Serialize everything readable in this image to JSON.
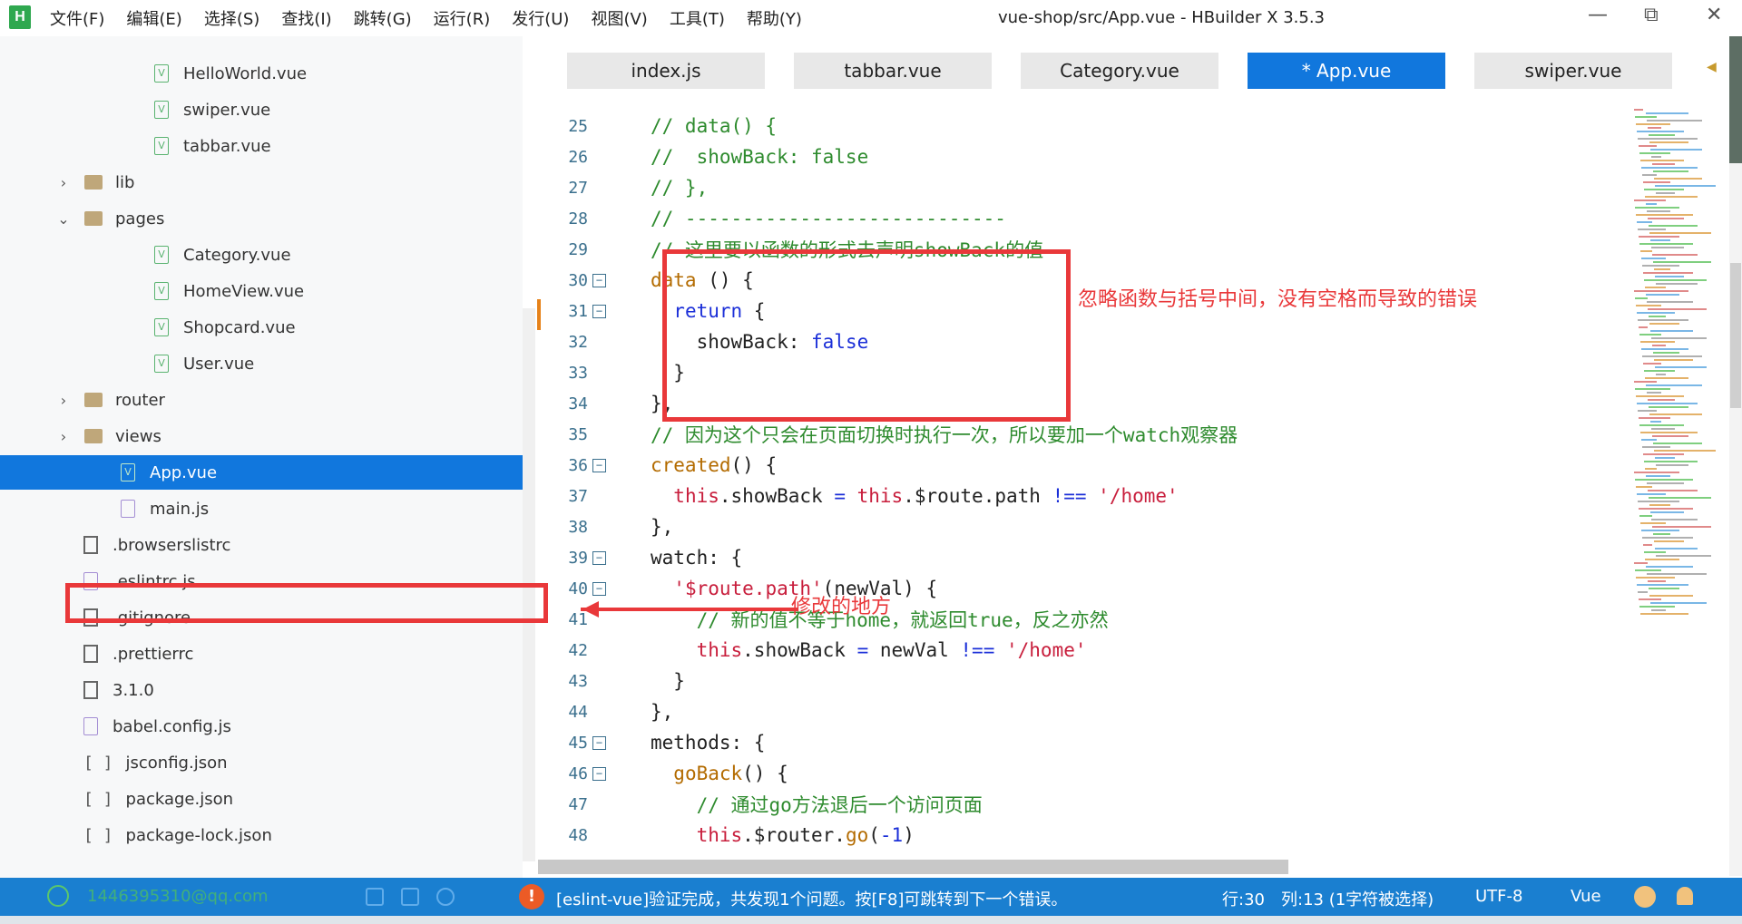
{
  "menu": [
    "文件(F)",
    "编辑(E)",
    "选择(S)",
    "查找(I)",
    "跳转(G)",
    "运行(R)",
    "发行(U)",
    "视图(V)",
    "工具(T)",
    "帮助(Y)"
  ],
  "window_title": "vue-shop/src/App.vue - HBuilder X 3.5.3",
  "window_controls": {
    "minimize": "—",
    "restore": "⧉",
    "close": "✕"
  },
  "logo": "H",
  "sidebar": {
    "items": [
      {
        "label": "HelloWorld.vue",
        "type": "vue"
      },
      {
        "label": "swiper.vue",
        "type": "vue"
      },
      {
        "label": "tabbar.vue",
        "type": "vue"
      },
      {
        "label": "lib",
        "type": "folder",
        "chevron": "›"
      },
      {
        "label": "pages",
        "type": "folder",
        "chevron": "⌄"
      },
      {
        "label": "Category.vue",
        "type": "vue"
      },
      {
        "label": "HomeView.vue",
        "type": "vue"
      },
      {
        "label": "Shopcard.vue",
        "type": "vue"
      },
      {
        "label": "User.vue",
        "type": "vue"
      },
      {
        "label": "router",
        "type": "folder",
        "chevron": "›"
      },
      {
        "label": "views",
        "type": "folder",
        "chevron": "›"
      },
      {
        "label": "App.vue",
        "type": "vue",
        "selected": true
      },
      {
        "label": "main.js",
        "type": "js"
      },
      {
        "label": ".browserslistrc",
        "type": "file"
      },
      {
        "label": ".eslintrc.js",
        "type": "js"
      },
      {
        "label": ".gitignore",
        "type": "file"
      },
      {
        "label": ".prettierrc",
        "type": "file"
      },
      {
        "label": "3.1.0",
        "type": "file"
      },
      {
        "label": "babel.config.js",
        "type": "js"
      },
      {
        "label": "jsconfig.json",
        "type": "json"
      },
      {
        "label": "package.json",
        "type": "json"
      },
      {
        "label": "package-lock.json",
        "type": "json"
      }
    ]
  },
  "tabs": [
    "index.js",
    "tabbar.vue",
    "Category.vue",
    "* App.vue",
    "swiper.vue"
  ],
  "code_lines": [
    {
      "n": "25",
      "fold": "",
      "parts": [
        [
          "g",
          "// data() {"
        ]
      ]
    },
    {
      "n": "26",
      "fold": "",
      "parts": [
        [
          "g",
          "//  showBack: false"
        ]
      ]
    },
    {
      "n": "27",
      "fold": "",
      "parts": [
        [
          "g",
          "// },"
        ]
      ]
    },
    {
      "n": "28",
      "fold": "",
      "parts": [
        [
          "g",
          "// ----------------------------"
        ]
      ]
    },
    {
      "n": "29",
      "fold": "",
      "parts": [
        [
          "g",
          "// 这里要以函数的形式去声明showBack的值"
        ]
      ]
    },
    {
      "n": "30",
      "fold": "−",
      "parts": [
        [
          "o",
          "data"
        ],
        [
          "n",
          " () {"
        ]
      ]
    },
    {
      "n": "31",
      "fold": "−",
      "parts": [
        [
          "n",
          "  "
        ],
        [
          "k",
          "return"
        ],
        [
          "n",
          " {"
        ]
      ]
    },
    {
      "n": "32",
      "fold": "",
      "parts": [
        [
          "n",
          "    showBack: "
        ],
        [
          "k",
          "false"
        ]
      ]
    },
    {
      "n": "33",
      "fold": "",
      "parts": [
        [
          "n",
          "  }"
        ]
      ]
    },
    {
      "n": "34",
      "fold": "",
      "parts": [
        [
          "n",
          "},"
        ]
      ]
    },
    {
      "n": "35",
      "fold": "",
      "parts": [
        [
          "g",
          "// 因为这个只会在页面切换时执行一次，所以要加一个watch观察器"
        ]
      ]
    },
    {
      "n": "36",
      "fold": "−",
      "parts": [
        [
          "o",
          "created"
        ],
        [
          "n",
          "() {"
        ]
      ]
    },
    {
      "n": "37",
      "fold": "",
      "parts": [
        [
          "n",
          "  "
        ],
        [
          "r",
          "this"
        ],
        [
          "n",
          ".showBack "
        ],
        [
          "k",
          "="
        ],
        [
          "n",
          " "
        ],
        [
          "r",
          "this"
        ],
        [
          "n",
          ".$route.path "
        ],
        [
          "k",
          "!=="
        ],
        [
          "n",
          " "
        ],
        [
          "r",
          "'/home'"
        ]
      ]
    },
    {
      "n": "38",
      "fold": "",
      "parts": [
        [
          "n",
          "},"
        ]
      ]
    },
    {
      "n": "39",
      "fold": "−",
      "parts": [
        [
          "n",
          "watch: {"
        ]
      ]
    },
    {
      "n": "40",
      "fold": "−",
      "parts": [
        [
          "n",
          "  "
        ],
        [
          "r",
          "'$route.path'"
        ],
        [
          "n",
          "(newVal) {"
        ]
      ]
    },
    {
      "n": "41",
      "fold": "",
      "parts": [
        [
          "n",
          "    "
        ],
        [
          "g",
          "// 新的值不等于home，就返回true，反之亦然"
        ]
      ]
    },
    {
      "n": "42",
      "fold": "",
      "parts": [
        [
          "n",
          "    "
        ],
        [
          "r",
          "this"
        ],
        [
          "n",
          ".showBack "
        ],
        [
          "k",
          "="
        ],
        [
          "n",
          " newVal "
        ],
        [
          "k",
          "!=="
        ],
        [
          "n",
          " "
        ],
        [
          "r",
          "'/home'"
        ]
      ]
    },
    {
      "n": "43",
      "fold": "",
      "parts": [
        [
          "n",
          "  }"
        ]
      ]
    },
    {
      "n": "44",
      "fold": "",
      "parts": [
        [
          "n",
          "},"
        ]
      ]
    },
    {
      "n": "45",
      "fold": "−",
      "parts": [
        [
          "n",
          "methods: {"
        ]
      ]
    },
    {
      "n": "46",
      "fold": "−",
      "parts": [
        [
          "n",
          "  "
        ],
        [
          "o",
          "goBack"
        ],
        [
          "n",
          "() {"
        ]
      ]
    },
    {
      "n": "47",
      "fold": "",
      "parts": [
        [
          "n",
          "    "
        ],
        [
          "g",
          "// 通过go方法退后一个访问页面"
        ]
      ]
    },
    {
      "n": "48",
      "fold": "",
      "parts": [
        [
          "n",
          "    "
        ],
        [
          "r",
          "this"
        ],
        [
          "n",
          ".$router."
        ],
        [
          "o",
          "go"
        ],
        [
          "n",
          "("
        ],
        [
          "k",
          "-1"
        ],
        [
          "n",
          ")"
        ]
      ]
    }
  ],
  "annotations": {
    "note1": "忽略函数与括号中间，没有空格而导致的错误",
    "note2": "修改的地方"
  },
  "status": {
    "account": "1446395310@qq.com",
    "message": "[eslint-vue]验证完成，共发现1个问题。按[F8]可跳转到下一个错误。",
    "error_icon": "!",
    "line": "行:30",
    "col": "列:13 (1字符被选择)",
    "encoding": "UTF-8",
    "language": "Vue"
  },
  "colors": {
    "accent": "#1177dd",
    "status_bar": "#1a7fd0",
    "annotation": "#e9383a",
    "comment": "#2e8b2e",
    "keyword": "#1b2fd8",
    "string": "#c81e3c",
    "function": "#b36b00"
  }
}
